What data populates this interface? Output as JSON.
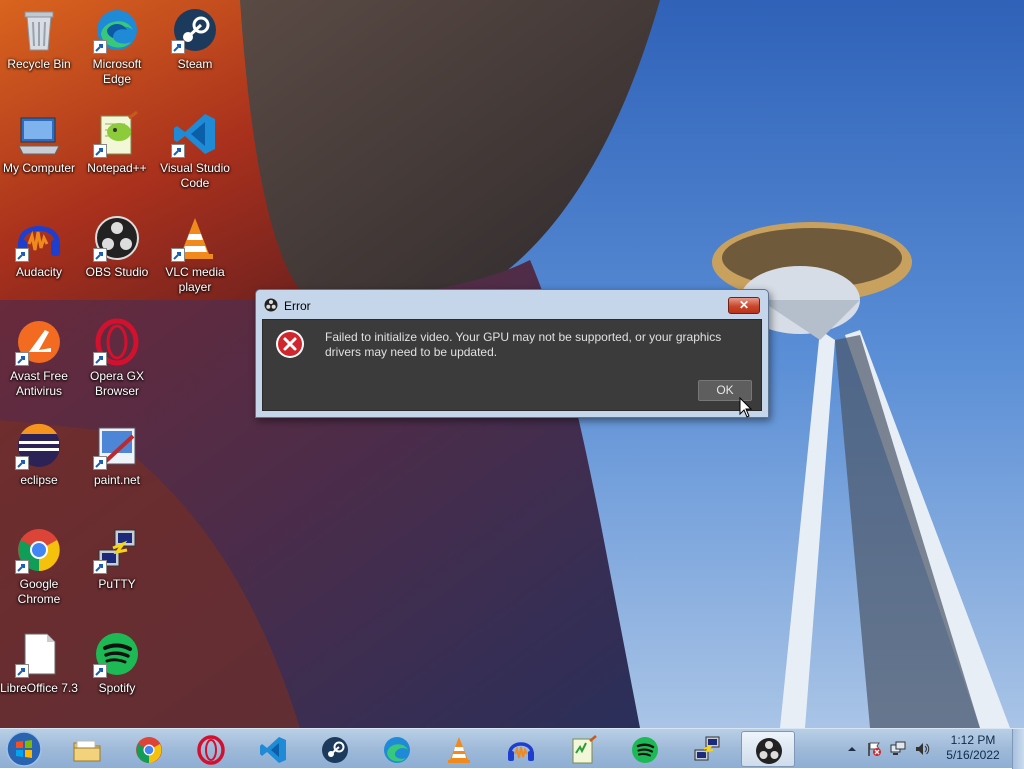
{
  "desktop": {
    "icons": [
      {
        "label": "Recycle Bin",
        "icon": "recycle-bin-icon"
      },
      {
        "label": "Microsoft Edge",
        "icon": "edge-icon"
      },
      {
        "label": "Steam",
        "icon": "steam-icon"
      },
      {
        "label": "My Computer",
        "icon": "computer-icon"
      },
      {
        "label": "Notepad++",
        "icon": "notepadpp-icon"
      },
      {
        "label": "Visual Studio Code",
        "icon": "vscode-icon"
      },
      {
        "label": "Audacity",
        "icon": "audacity-icon"
      },
      {
        "label": "OBS Studio",
        "icon": "obs-icon"
      },
      {
        "label": "VLC media player",
        "icon": "vlc-icon"
      },
      {
        "label": "Avast Free Antivirus",
        "icon": "avast-icon"
      },
      {
        "label": "Opera GX Browser",
        "icon": "opera-icon"
      },
      {
        "label": "eclipse",
        "icon": "eclipse-icon"
      },
      {
        "label": "paint.net",
        "icon": "paintnet-icon"
      },
      {
        "label": "Google Chrome",
        "icon": "chrome-icon"
      },
      {
        "label": "PuTTY",
        "icon": "putty-icon"
      },
      {
        "label": "LibreOffice 7.3",
        "icon": "libreoffice-icon"
      },
      {
        "label": "Spotify",
        "icon": "spotify-icon"
      }
    ]
  },
  "dialog": {
    "title": "Error",
    "close_label": "✕",
    "message": "Failed to initialize video.  Your GPU may not be supported, or your graphics drivers may need to be updated.",
    "ok_label": "OK",
    "icon": "error-icon"
  },
  "taskbar": {
    "start": "windows-start-icon",
    "pinned": [
      "file-explorer-icon",
      "chrome-icon",
      "opera-icon",
      "vscode-icon",
      "steam-icon",
      "edge-icon",
      "vlc-icon",
      "audacity-icon",
      "notepadpp-icon",
      "spotify-icon",
      "putty-icon",
      "obs-icon"
    ],
    "active": "obs-icon",
    "tray": [
      "show-hidden-icons-icon",
      "action-center-flag-icon",
      "network-icon",
      "volume-icon"
    ],
    "clock": {
      "time": "1:12 PM",
      "date": "5/16/2022"
    }
  },
  "colors": {
    "dialog_frame": "#c6d6ea",
    "dialog_body": "#3b3b3b",
    "close_button": "#c9462c",
    "taskbar": "#9fbad9"
  }
}
